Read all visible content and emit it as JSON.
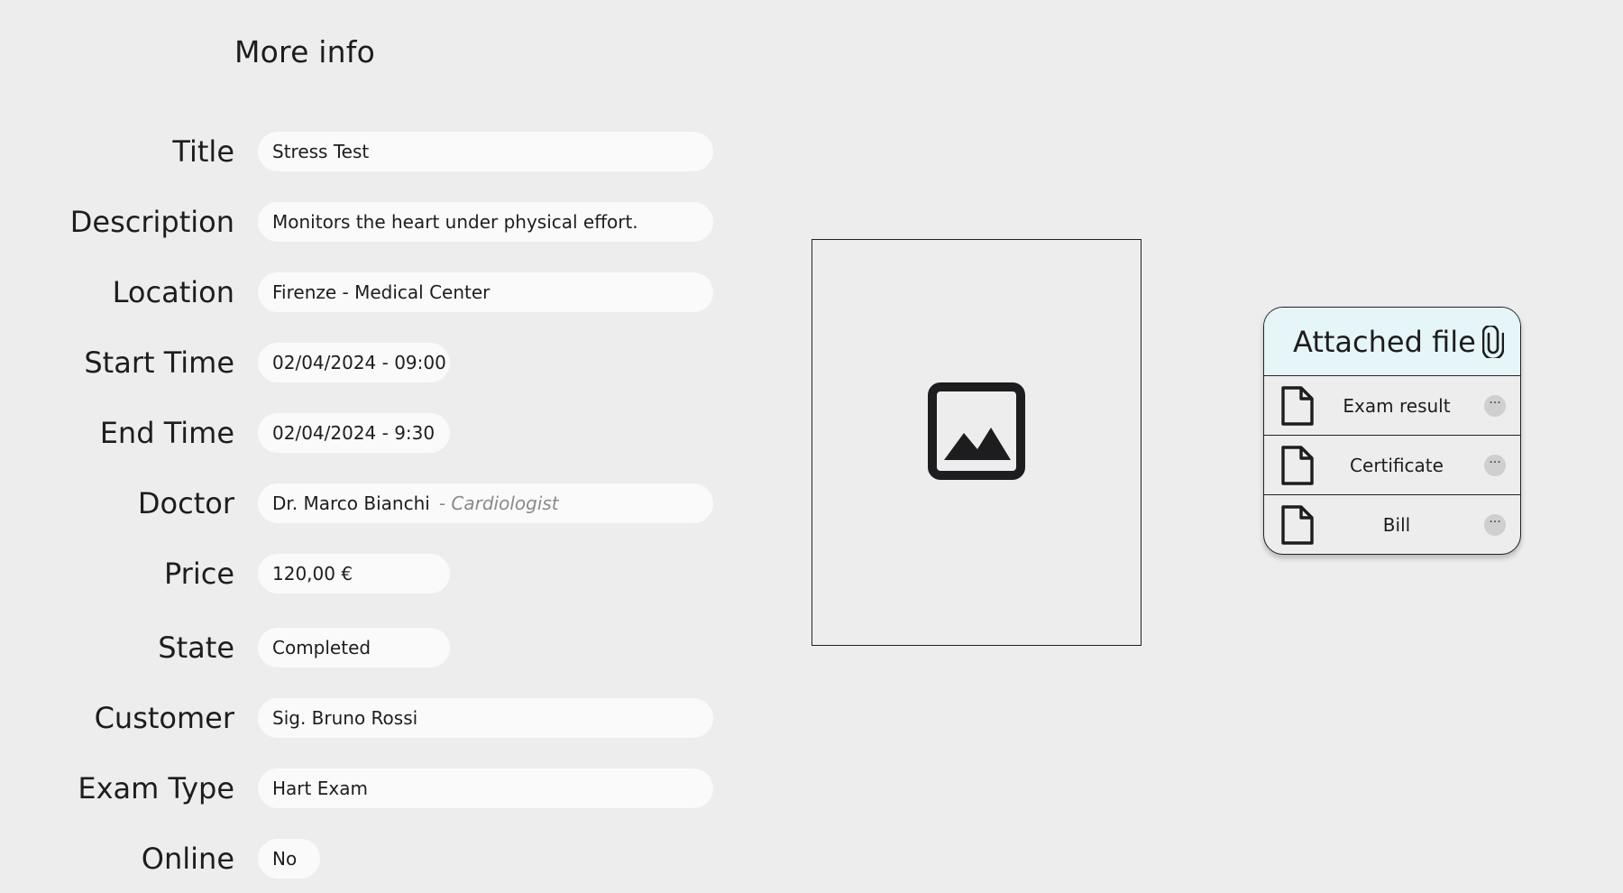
{
  "page": {
    "title": "More info"
  },
  "form": {
    "title": {
      "label": "Title",
      "value": "Stress Test"
    },
    "description": {
      "label": "Description",
      "value": "Monitors the heart under physical effort."
    },
    "location": {
      "label": "Location",
      "value": "Firenze - Medical Center"
    },
    "start_time": {
      "label": "Start Time",
      "value": "02/04/2024 - 09:00"
    },
    "end_time": {
      "label": "End Time",
      "value": "02/04/2024 - 9:30"
    },
    "doctor": {
      "label": "Doctor",
      "value": "Dr. Marco Bianchi",
      "specialty": "- Cardiologist"
    },
    "price": {
      "label": "Price",
      "value": "120,00 €"
    },
    "state": {
      "label": "State",
      "value": "Completed"
    },
    "customer": {
      "label": "Customer",
      "value": "Sig. Bruno Rossi"
    },
    "exam_type": {
      "label": "Exam Type",
      "value": "Hart Exam"
    },
    "online": {
      "label": "Online",
      "value": "No"
    }
  },
  "image_placeholder": {
    "icon": "image-icon"
  },
  "attachments": {
    "title": "Attached file",
    "icon": "paperclip-icon",
    "files": [
      {
        "name": "Exam result",
        "icon": "file-icon"
      },
      {
        "name": "Certificate",
        "icon": "file-icon"
      },
      {
        "name": "Bill",
        "icon": "file-icon"
      }
    ],
    "more_label": "···"
  }
}
